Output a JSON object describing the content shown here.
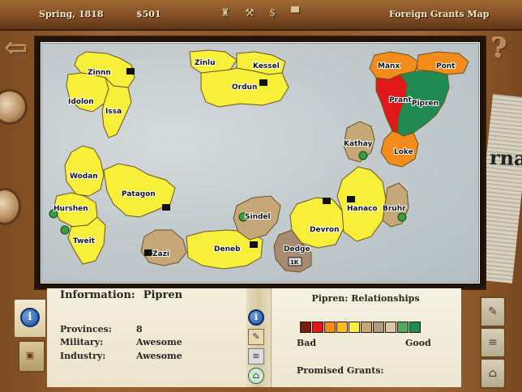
{
  "header": {
    "date": "Spring, 1818",
    "money": "$501",
    "screen_title": "Foreign Grants Map",
    "icons": [
      "worker-icon",
      "mill-icon",
      "money-icon",
      "top-hat-icon"
    ]
  },
  "map": {
    "territories": [
      {
        "name": "Zinnn",
        "color": "#f7ef3a"
      },
      {
        "name": "Idolon",
        "color": "#f7ef3a"
      },
      {
        "name": "Issa",
        "color": "#f7ef3a"
      },
      {
        "name": "Zinlu",
        "color": "#f7ef3a"
      },
      {
        "name": "Kessel",
        "color": "#f7ef3a"
      },
      {
        "name": "Ordun",
        "color": "#f7ef3a"
      },
      {
        "name": "Manx",
        "color": "#f48c1c"
      },
      {
        "name": "Pont",
        "color": "#f48c1c"
      },
      {
        "name": "Prant",
        "color": "#e01818"
      },
      {
        "name": "Pipren",
        "color": "#1f8a52"
      },
      {
        "name": "Kathay",
        "color": "#c6a878"
      },
      {
        "name": "Loke",
        "color": "#f48c1c"
      },
      {
        "name": "Wodan",
        "color": "#f7ef3a"
      },
      {
        "name": "Patagon",
        "color": "#f7ef3a"
      },
      {
        "name": "Hurshen",
        "color": "#f7ef3a"
      },
      {
        "name": "Tweit",
        "color": "#f7ef3a"
      },
      {
        "name": "Zazi",
        "color": "#c6a878"
      },
      {
        "name": "Deneb",
        "color": "#f7ef3a"
      },
      {
        "name": "Sindel",
        "color": "#c6a878"
      },
      {
        "name": "Dedge",
        "color": "#a88a70"
      },
      {
        "name": "Devron",
        "color": "#f7ef3a"
      },
      {
        "name": "Hanaco",
        "color": "#f7ef3a"
      },
      {
        "name": "Bruhr",
        "color": "#c6a878"
      }
    ],
    "capital_badge": "1K"
  },
  "info": {
    "heading": "Information:",
    "nation": "Pipren",
    "provinces_label": "Provinces:",
    "provinces_value": "8",
    "military_label": "Military:",
    "military_value": "Awesome",
    "industry_label": "Industry:",
    "industry_value": "Awesome"
  },
  "relationships": {
    "title": "Pipren: Relationships",
    "scale_colors": [
      "#7a1e10",
      "#e01818",
      "#f48c1c",
      "#f7c021",
      "#f7ef3a",
      "#c6a878",
      "#b09a80",
      "#d9c8a8",
      "#4eaa5c",
      "#1f8a52"
    ],
    "bad_label": "Bad",
    "good_label": "Good",
    "promised_grants_label": "Promised Grants:"
  },
  "side": {
    "newspaper_masthead": "rna"
  }
}
